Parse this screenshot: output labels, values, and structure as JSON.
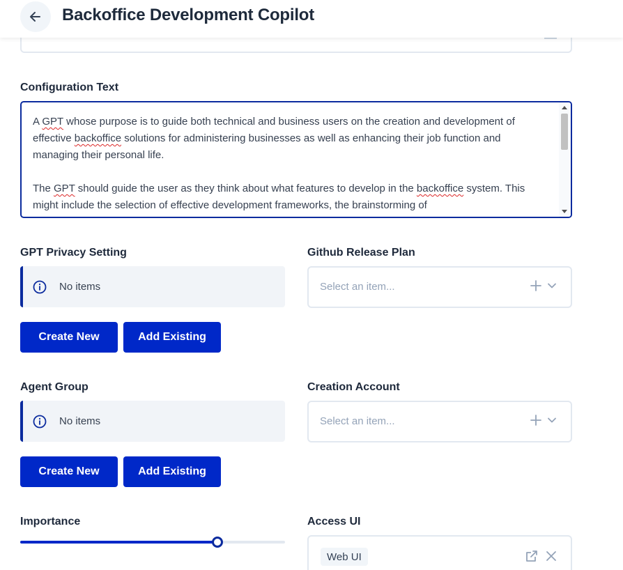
{
  "header": {
    "title": "Backoffice Development Copilot"
  },
  "config": {
    "label": "Configuration Text",
    "text_parts": [
      "A ",
      "GPT",
      " whose purpose is to guide both technical and business users on the creation and development of effective ",
      "backoffice",
      " solutions for administering businesses as well as enhancing their job function and managing their personal life.\n\nThe ",
      "GPT",
      " should guide the user as they think about what features to develop in the ",
      "backoffice",
      " system. This might include the selection of effective development frameworks, the brainstorming of"
    ]
  },
  "privacy": {
    "label": "GPT Privacy Setting",
    "empty_text": "No items",
    "create_label": "Create New",
    "add_label": "Add Existing"
  },
  "github": {
    "label": "Github Release Plan",
    "placeholder": "Select an item..."
  },
  "agent_group": {
    "label": "Agent Group",
    "empty_text": "No items",
    "create_label": "Create New",
    "add_label": "Add Existing"
  },
  "creation_account": {
    "label": "Creation Account",
    "placeholder": "Select an item..."
  },
  "importance": {
    "label": "Importance",
    "value_fraction": 0.745
  },
  "access_ui": {
    "label": "Access UI",
    "chip": "Web UI"
  },
  "colors": {
    "primary": "#0028c8",
    "focus_border": "#0b2b9e",
    "text": "#1e293b",
    "muted": "#94a3b8"
  }
}
